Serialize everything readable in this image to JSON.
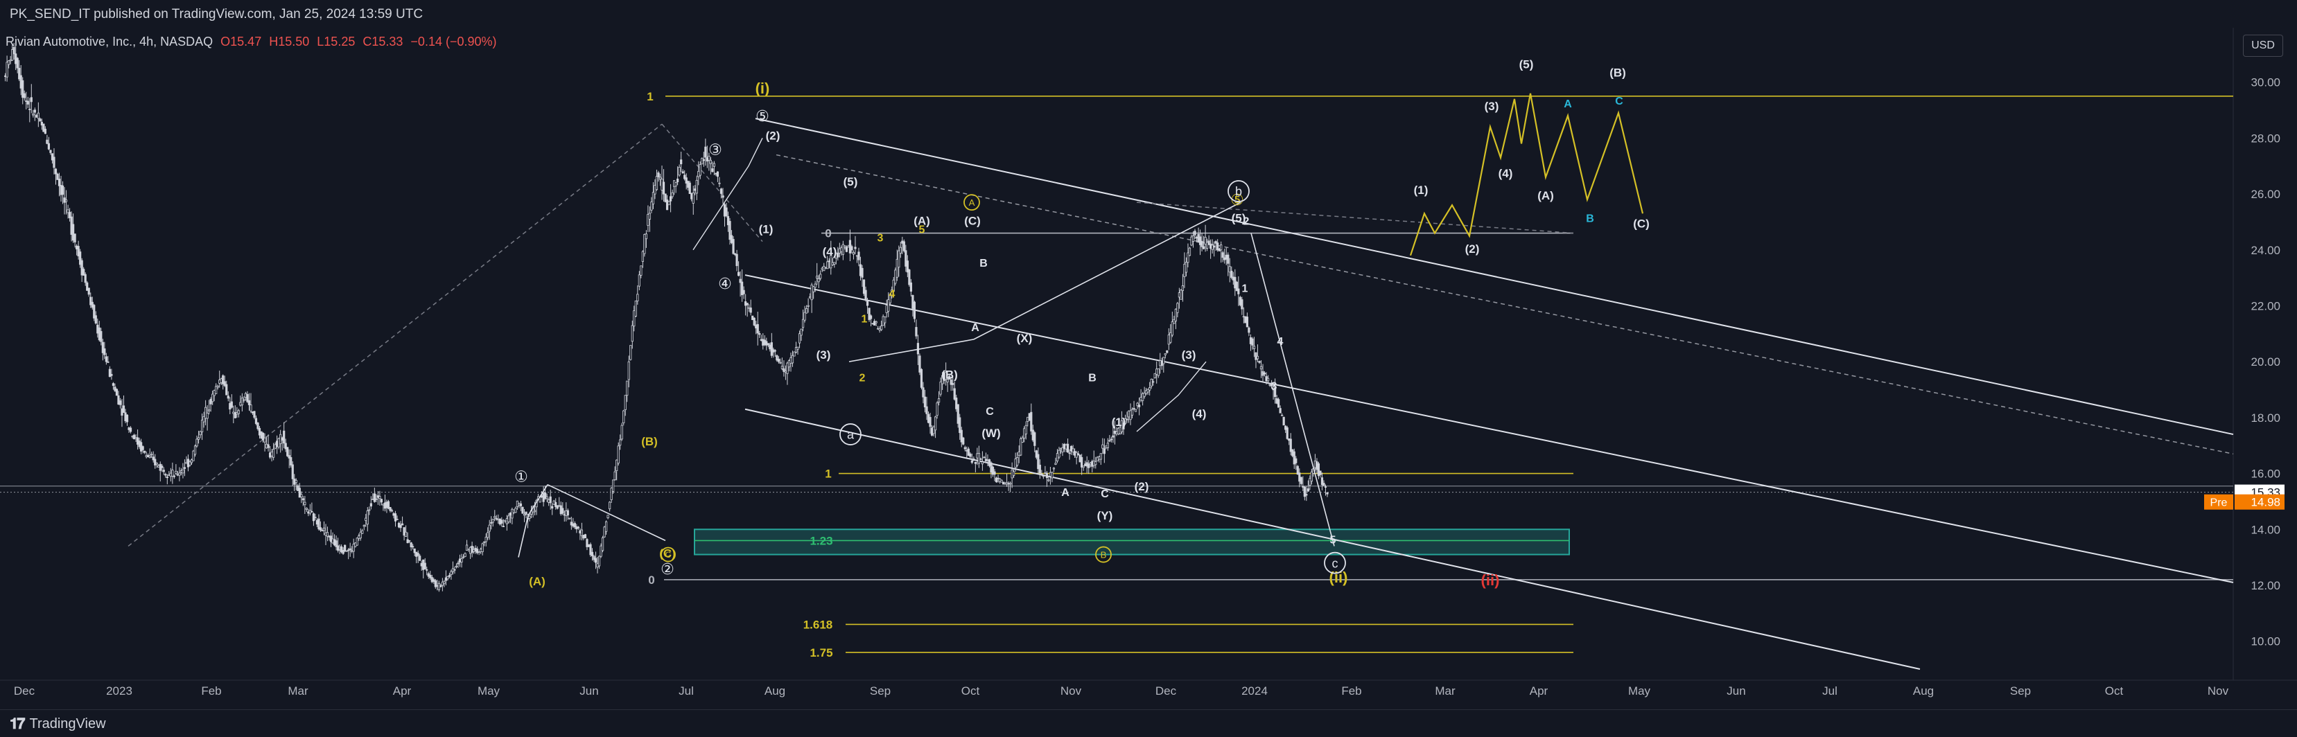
{
  "header": {
    "published_by": "PK_SEND_IT published on TradingView.com, Jan 25, 2024 13:59 UTC"
  },
  "legend": {
    "symbol": "Rivian Automotive, Inc., 4h, NASDAQ",
    "open": "O15.47",
    "high": "H15.50",
    "low": "L15.25",
    "close": "C15.33",
    "change": "−0.14 (−0.90%)",
    "up_color": "#26a69a",
    "down_color": "#ef5350"
  },
  "currency_button": "USD",
  "footer": {
    "brand": "TradingView",
    "logo_icon": "tradingview-logo-icon"
  },
  "chart_data": {
    "type": "candlestick",
    "y_axis": {
      "ticks": [
        "10.00",
        "12.00",
        "14.00",
        "16.00",
        "18.00",
        "20.00",
        "22.00",
        "24.00",
        "26.00",
        "28.00",
        "30.00"
      ],
      "range": [
        9.2,
        31.5
      ]
    },
    "x_axis": {
      "ticks": [
        "Dec",
        "2023",
        "Feb",
        "Mar",
        "Apr",
        "May",
        "Jun",
        "Jul",
        "Aug",
        "Sep",
        "Oct",
        "Nov",
        "Dec",
        "2024",
        "Feb",
        "Mar",
        "Apr",
        "May",
        "Jun",
        "Jul",
        "Aug",
        "Sep",
        "Oct",
        "Nov"
      ]
    },
    "price_labels": [
      {
        "text": "15.33",
        "value": 15.33,
        "bg": "#ffffff",
        "fg": "#131722"
      },
      {
        "tag": "Pre",
        "text": "14.98",
        "value": 14.98,
        "bg": "#f57c00",
        "fg": "#ffffff"
      }
    ],
    "price_path": [
      [
        0,
        30.2
      ],
      [
        0.5,
        31.2
      ],
      [
        1,
        29.5
      ],
      [
        2,
        28.3
      ],
      [
        2.7,
        26.5
      ],
      [
        3.3,
        25
      ],
      [
        4,
        23
      ],
      [
        4.7,
        21
      ],
      [
        5.5,
        19
      ],
      [
        6.3,
        17.5
      ],
      [
        7,
        16.7
      ],
      [
        7.8,
        16.2
      ],
      [
        8.5,
        15.9
      ],
      [
        9.3,
        16.5
      ],
      [
        10,
        18.2
      ],
      [
        10.8,
        19.5
      ],
      [
        11.4,
        18
      ],
      [
        12,
        18.8
      ],
      [
        12.6,
        17.6
      ],
      [
        13.2,
        16.7
      ],
      [
        13.8,
        17.4
      ],
      [
        14.3,
        16
      ],
      [
        14.9,
        14.8
      ],
      [
        15.6,
        14.2
      ],
      [
        16.5,
        13.4
      ],
      [
        17.2,
        13.2
      ],
      [
        17.8,
        14
      ],
      [
        18.3,
        15.2
      ],
      [
        19,
        14.9
      ],
      [
        19.6,
        14.2
      ],
      [
        20.2,
        13.4
      ],
      [
        20.8,
        12.7
      ],
      [
        21.5,
        11.9
      ],
      [
        22.2,
        12.5
      ],
      [
        23,
        13.3
      ],
      [
        23.6,
        13.2
      ],
      [
        24.2,
        14.4
      ],
      [
        24.8,
        14.2
      ],
      [
        25.5,
        14.9
      ],
      [
        26,
        14.4
      ],
      [
        26.6,
        15.2
      ],
      [
        27.3,
        14.9
      ],
      [
        28,
        14.4
      ],
      [
        28.8,
        13.7
      ],
      [
        29.4,
        12.6
      ],
      [
        30,
        14.9
      ],
      [
        30.6,
        17.5
      ],
      [
        31.2,
        21.5
      ],
      [
        31.8,
        24.6
      ],
      [
        32.4,
        26.8
      ],
      [
        32.9,
        25.5
      ],
      [
        33.5,
        27
      ],
      [
        34.1,
        25.8
      ],
      [
        34.7,
        27.5
      ],
      [
        35.4,
        26.5
      ],
      [
        36,
        24.5
      ],
      [
        36.6,
        22.5
      ],
      [
        37.1,
        21.5
      ],
      [
        37.6,
        20.7
      ],
      [
        38.2,
        20.3
      ],
      [
        38.7,
        19.6
      ],
      [
        39.3,
        20.5
      ],
      [
        39.9,
        22.3
      ],
      [
        40.5,
        23.3
      ],
      [
        41.1,
        23.6
      ],
      [
        41.7,
        24.2
      ],
      [
        42.3,
        23.8
      ],
      [
        42.9,
        21.5
      ],
      [
        43.4,
        21.1
      ],
      [
        44,
        22.5
      ],
      [
        44.5,
        24.4
      ],
      [
        45,
        22.3
      ],
      [
        45.5,
        18.8
      ],
      [
        46,
        17.4
      ],
      [
        46.5,
        19.5
      ],
      [
        47,
        19.3
      ],
      [
        47.5,
        17
      ],
      [
        48,
        16.5
      ],
      [
        48.6,
        16.6
      ],
      [
        49.2,
        15.8
      ],
      [
        49.8,
        15.5
      ],
      [
        50.3,
        16.8
      ],
      [
        50.8,
        18.2
      ],
      [
        51.3,
        16
      ],
      [
        51.8,
        15.8
      ],
      [
        52.4,
        17
      ],
      [
        53,
        16.8
      ],
      [
        53.6,
        16.2
      ],
      [
        54.2,
        16.5
      ],
      [
        54.8,
        17.2
      ],
      [
        55.3,
        17.6
      ],
      [
        55.9,
        18.2
      ],
      [
        56.5,
        18.8
      ],
      [
        57.1,
        19.6
      ],
      [
        57.7,
        20.6
      ],
      [
        58.3,
        22.5
      ],
      [
        58.9,
        24.6
      ],
      [
        59.5,
        24.2
      ],
      [
        60,
        24.2
      ],
      [
        60.5,
        23.7
      ],
      [
        61,
        22.8
      ],
      [
        61.5,
        21.5
      ],
      [
        62,
        20.2
      ],
      [
        62.5,
        19.5
      ],
      [
        63,
        18.8
      ],
      [
        63.5,
        17.6
      ],
      [
        64,
        16.3
      ],
      [
        64.5,
        15.2
      ],
      [
        65,
        16.4
      ],
      [
        65.5,
        15.33
      ]
    ],
    "waves": {
      "count_labels_white": [
        "(2)",
        "(1)",
        "(5)",
        "(3)",
        "(4)",
        "(A)",
        "(C)",
        "B",
        "A",
        "(X)",
        "(B)",
        "C",
        "(W)",
        "B",
        "(1)",
        "A",
        "C",
        "(Y)",
        "(2)",
        "(3)",
        "(4)",
        "(5)",
        "1",
        "2",
        "3",
        "4",
        "5",
        "(1)",
        "(2)",
        "(3)",
        "(4)",
        "(5)",
        "(A)",
        "(B)",
        "(C)"
      ],
      "count_labels_yellow": [
        "(i)",
        "(ii)",
        "(A)",
        "(B)",
        "(C)",
        "3",
        "4",
        "5",
        "1",
        "2"
      ],
      "count_labels_cyan": [
        "A",
        "B",
        "C"
      ],
      "count_labels_red": [
        "(ii)"
      ],
      "circled_numbers": [
        "①",
        "②",
        "③",
        "④",
        "⑤",
        "⑤"
      ],
      "circled_letters": [
        "a",
        "b",
        "c",
        "A",
        "B",
        "C"
      ]
    },
    "fib_levels": [
      {
        "text": "1",
        "value": 29.5,
        "color": "#d4c026"
      },
      {
        "text": "0",
        "value": 24.6,
        "color": "#b2b5be"
      },
      {
        "text": "1",
        "value": 16.0,
        "color": "#d4c026"
      },
      {
        "text": "1.23",
        "value": 13.6,
        "color": "#2fbf71"
      },
      {
        "text": "0",
        "value": 12.2,
        "color": "#b2b5be"
      },
      {
        "text": "1.618",
        "value": 10.6,
        "color": "#d4c026"
      },
      {
        "text": "1.75",
        "value": 9.6,
        "color": "#d4c026"
      }
    ],
    "target_zone": {
      "low": 13.1,
      "high": 14.0,
      "color": "#26a69a"
    },
    "xlabel": "",
    "ylabel": "",
    "grid": false
  }
}
